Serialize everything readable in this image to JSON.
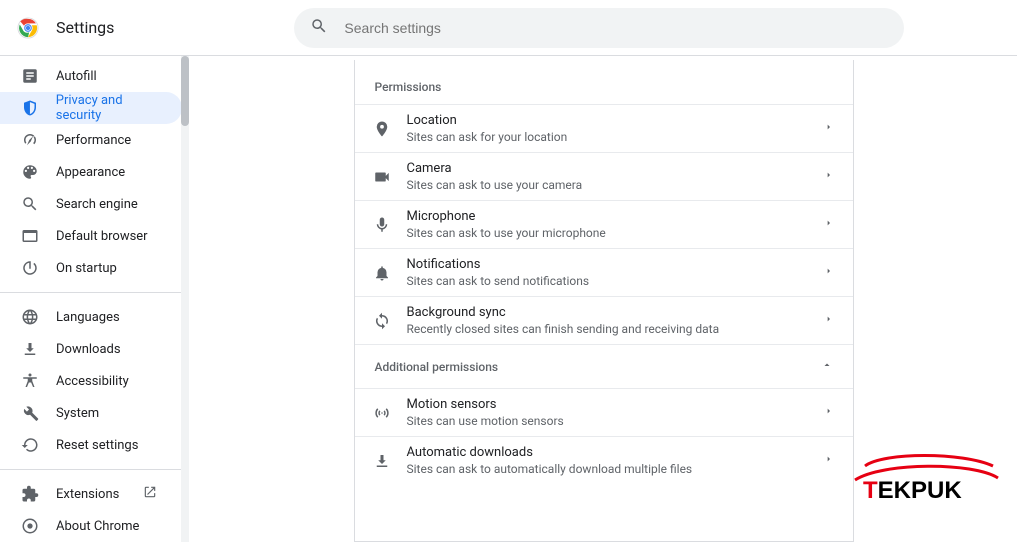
{
  "app": {
    "title": "Settings"
  },
  "search": {
    "placeholder": "Search settings"
  },
  "sidebar": {
    "items": [
      {
        "label": "Autofill",
        "icon": "autofill-icon",
        "active": false
      },
      {
        "label": "Privacy and security",
        "icon": "shield-icon",
        "active": true
      },
      {
        "label": "Performance",
        "icon": "speed-icon",
        "active": false
      },
      {
        "label": "Appearance",
        "icon": "palette-icon",
        "active": false
      },
      {
        "label": "Search engine",
        "icon": "search-icon",
        "active": false
      },
      {
        "label": "Default browser",
        "icon": "browser-icon",
        "active": false
      },
      {
        "label": "On startup",
        "icon": "power-icon",
        "active": false
      }
    ],
    "items2": [
      {
        "label": "Languages",
        "icon": "globe-icon"
      },
      {
        "label": "Downloads",
        "icon": "download-icon"
      },
      {
        "label": "Accessibility",
        "icon": "accessibility-icon"
      },
      {
        "label": "System",
        "icon": "wrench-icon"
      },
      {
        "label": "Reset settings",
        "icon": "restore-icon"
      }
    ],
    "items3": [
      {
        "label": "Extensions",
        "icon": "extension-icon",
        "external": true
      },
      {
        "label": "About Chrome",
        "icon": "chrome-icon"
      }
    ]
  },
  "content": {
    "section1_title": "Permissions",
    "rows": [
      {
        "title": "Location",
        "desc": "Sites can ask for your location",
        "icon": "location-icon"
      },
      {
        "title": "Camera",
        "desc": "Sites can ask to use your camera",
        "icon": "camera-icon"
      },
      {
        "title": "Microphone",
        "desc": "Sites can ask to use your microphone",
        "icon": "mic-icon"
      },
      {
        "title": "Notifications",
        "desc": "Sites can ask to send notifications",
        "icon": "bell-icon"
      },
      {
        "title": "Background sync",
        "desc": "Recently closed sites can finish sending and receiving data",
        "icon": "sync-icon"
      }
    ],
    "section2_title": "Additional permissions",
    "rows2": [
      {
        "title": "Motion sensors",
        "desc": "Sites can use motion sensors",
        "icon": "sensors-icon"
      },
      {
        "title": "Automatic downloads",
        "desc": "Sites can ask to automatically download multiple files",
        "icon": "download-icon"
      }
    ]
  },
  "watermark": {
    "text": "TEKPUK"
  }
}
